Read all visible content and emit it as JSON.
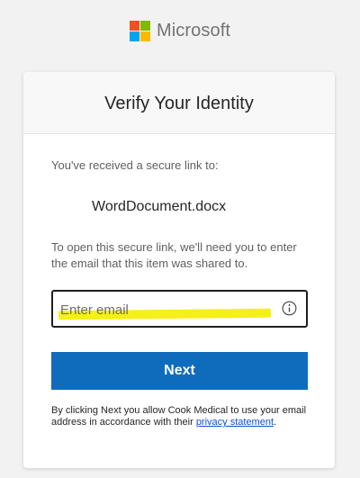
{
  "brand": {
    "name": "Microsoft",
    "logo_colors": [
      "#f25022",
      "#7fba00",
      "#00a4ef",
      "#ffb900"
    ]
  },
  "card": {
    "title": "Verify Your Identity",
    "intro": "You've received a secure link to:",
    "filename": "WordDocument.docx",
    "instructions": "To open this secure link, we'll need you to enter the email that this item was shared to.",
    "email": {
      "placeholder": "Enter email",
      "value": "",
      "info_icon": "info-icon"
    },
    "next_label": "Next",
    "consent": {
      "prefix": "By clicking Next you allow Cook Medical to use your email address in accordance with their ",
      "link_text": "privacy statement",
      "suffix": "."
    }
  },
  "colors": {
    "accent": "#0f6cbd",
    "highlight": "#f5ef1c",
    "page_background": "#f2f2f2"
  }
}
